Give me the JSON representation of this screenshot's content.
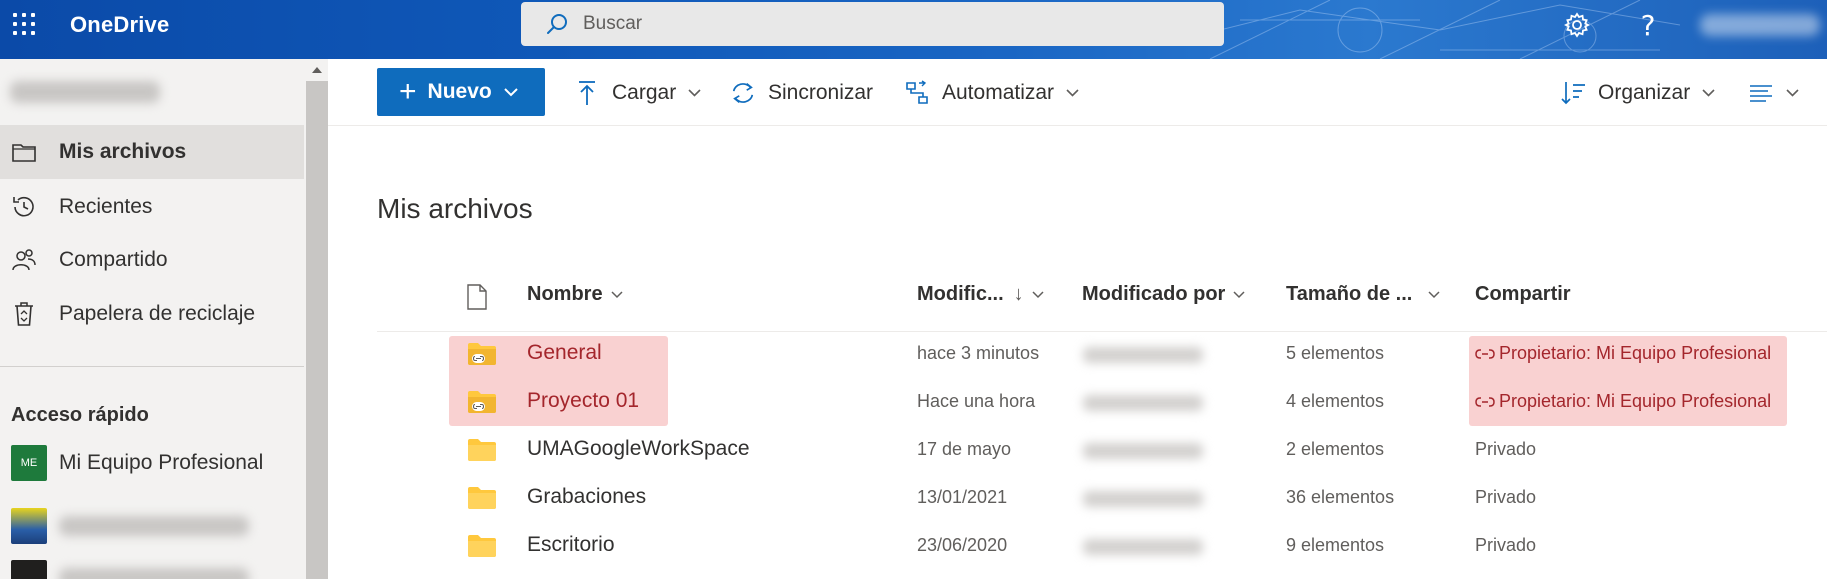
{
  "app": {
    "title": "OneDrive",
    "search_placeholder": "Buscar",
    "help_symbol": "?"
  },
  "colors": {
    "brand_blue": "#0f6cbd",
    "highlight": "#f9d1d1",
    "highlight_text": "#a4262c",
    "folder": "#ffc83d"
  },
  "nav": {
    "items": [
      {
        "label": "Mis archivos",
        "icon": "folder-icon",
        "active": true
      },
      {
        "label": "Recientes",
        "icon": "history-icon",
        "active": false
      },
      {
        "label": "Compartido",
        "icon": "people-icon",
        "active": false
      },
      {
        "label": "Papelera de reciclaje",
        "icon": "recycle-bin-icon",
        "active": false
      }
    ],
    "quick_access_title": "Acceso rápido",
    "quick_access": [
      {
        "label": "Mi Equipo Profesional",
        "badge": "ME",
        "badge_color": "#1e7a3c"
      }
    ]
  },
  "commands": {
    "new_label": "Nuevo",
    "upload_label": "Cargar",
    "sync_label": "Sincronizar",
    "automate_label": "Automatizar",
    "sort_label": "Organizar"
  },
  "main": {
    "title": "Mis archivos",
    "columns": {
      "name": "Nombre",
      "modified": "Modific...",
      "modified_sort_arrow": "↓",
      "modified_by": "Modificado por",
      "size": "Tamaño de ...",
      "sharing": "Compartir"
    },
    "rows": [
      {
        "name": "General",
        "modified": "hace 3 minutos",
        "size": "5 elementos",
        "sharing": "Propietario: Mi Equipo Profesional",
        "shared": true
      },
      {
        "name": "Proyecto 01",
        "modified": "Hace una hora",
        "size": "4 elementos",
        "sharing": "Propietario: Mi Equipo Profesional",
        "shared": true
      },
      {
        "name": "UMAGoogleWorkSpace",
        "modified": "17 de mayo",
        "size": "2 elementos",
        "sharing": "Privado",
        "shared": false
      },
      {
        "name": "Grabaciones",
        "modified": "13/01/2021",
        "size": "36 elementos",
        "sharing": "Privado",
        "shared": false
      },
      {
        "name": "Escritorio",
        "modified": "23/06/2020",
        "size": "9 elementos",
        "sharing": "Privado",
        "shared": false
      }
    ]
  }
}
